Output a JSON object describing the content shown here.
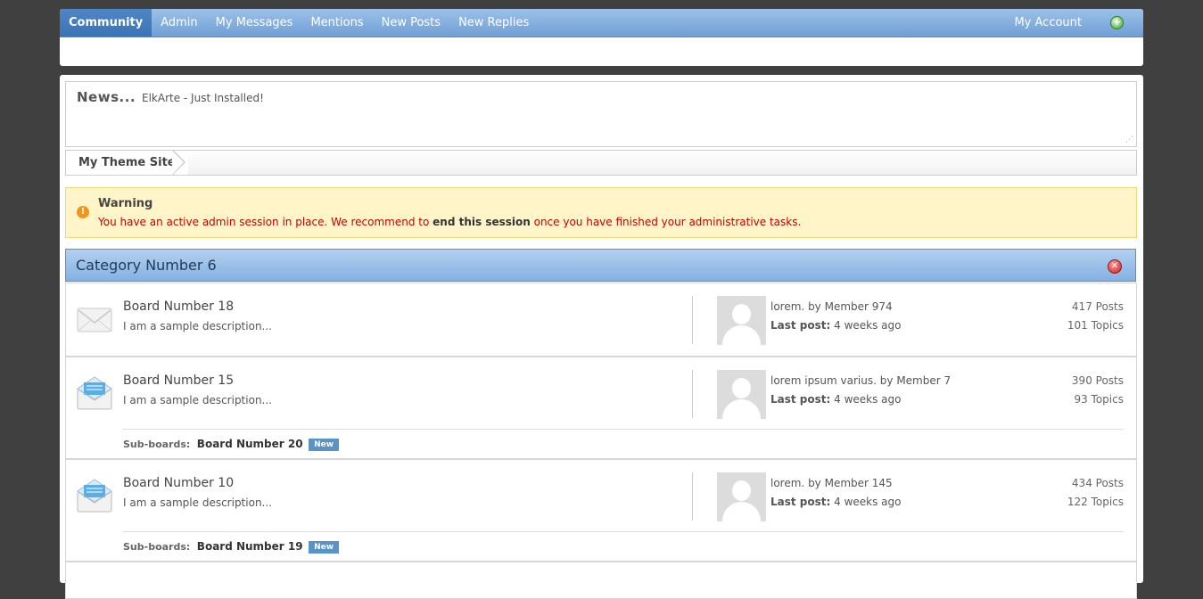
{
  "menu": {
    "items": [
      {
        "label": "Community"
      },
      {
        "label": "Admin"
      },
      {
        "label": "My Messages"
      },
      {
        "label": "Mentions"
      },
      {
        "label": "New Posts"
      },
      {
        "label": "New Replies"
      }
    ],
    "account_label": "My Account",
    "plus_icon": "plus-circle-icon"
  },
  "news": {
    "title": "News...",
    "text": "ElkArte - Just Installed!"
  },
  "breadcrumb": {
    "label": "My Theme Site"
  },
  "warning": {
    "title": "Warning",
    "text_before": "You have an active admin session in place. We recommend to ",
    "link": "end this session",
    "text_after": " once you have finished your administrative tasks."
  },
  "category": {
    "title": "Category Number 6",
    "boards": [
      {
        "name": "Board Number 18",
        "description": "I am a sample description...",
        "last_post_title": "lorem.",
        "last_post_by": "by Member 974",
        "last_post_label": "Last post:",
        "last_post_time": "4 weeks ago",
        "posts": "417 Posts",
        "topics": "101 Topics",
        "icon": "envelope-closed-icon"
      },
      {
        "name": "Board Number 15",
        "description": "I am a sample description...",
        "last_post_title": "lorem ipsum varius.",
        "last_post_by": "by Member 7",
        "last_post_label": "Last post:",
        "last_post_time": "4 weeks ago",
        "posts": "390 Posts",
        "topics": "93 Topics",
        "icon": "envelope-open-icon",
        "subboards_label": "Sub-boards:",
        "subboard_name": "Board Number 20",
        "subboard_badge": "New"
      },
      {
        "name": "Board Number 10",
        "description": "I am a sample description...",
        "last_post_title": "lorem.",
        "last_post_by": "by Member 145",
        "last_post_label": "Last post:",
        "last_post_time": "4 weeks ago",
        "posts": "434 Posts",
        "topics": "122 Topics",
        "icon": "envelope-open-icon",
        "subboards_label": "Sub-boards:",
        "subboard_name": "Board Number 19",
        "subboard_badge": "New"
      }
    ]
  },
  "colors": {
    "menu_bar": "#7aa8da",
    "active_tab": "#4680c2",
    "warning_bg": "#fff5c9",
    "warning_text": "#c40000",
    "category_header": "#9ec2ea",
    "new_badge": "#5a93c8"
  }
}
